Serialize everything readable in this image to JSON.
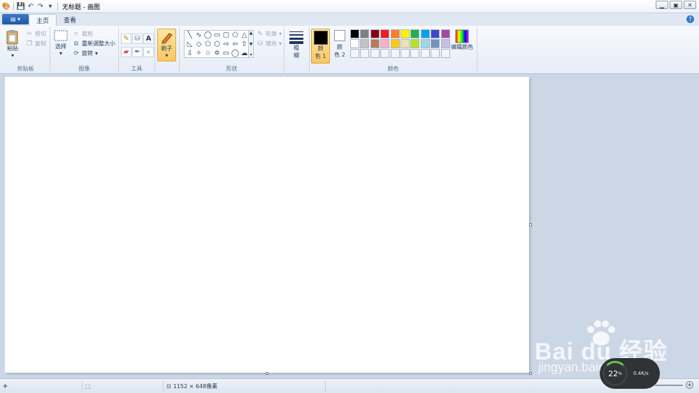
{
  "window": {
    "title": "无标题 - 画图"
  },
  "tabs": [
    {
      "label": "主页"
    },
    {
      "label": "查看"
    }
  ],
  "clipboard": {
    "paste": "粘贴",
    "cut": "剪切",
    "copy": "复制",
    "group": "剪贴板"
  },
  "image": {
    "select": "选择",
    "crop": "裁剪",
    "resize": "重新调整大小",
    "rotate": "旋转",
    "group": "图像"
  },
  "tools": {
    "group": "工具"
  },
  "brushes": {
    "label": "刷子"
  },
  "shapes": {
    "outline": "轮廓",
    "fill": "填充",
    "group": "形状"
  },
  "size": {
    "label_top": "粗",
    "label_bottom": "细"
  },
  "colors": {
    "color1_top": "颜",
    "color1_bottom": "色 1",
    "color2_top": "颜",
    "color2_bottom": "色 2",
    "edit": "编辑颜色",
    "group": "颜色",
    "color1": "#000000",
    "color2": "#ffffff",
    "palette_row1": [
      "#000000",
      "#7f7f7f",
      "#880015",
      "#ed1c24",
      "#ff7f27",
      "#fff200",
      "#22b14c",
      "#00a2e8",
      "#3f48cc",
      "#a349a4"
    ],
    "palette_row2": [
      "#ffffff",
      "#c3c3c3",
      "#b97a57",
      "#ffaec9",
      "#ffc90e",
      "#efe4b0",
      "#b5e61d",
      "#99d9ea",
      "#7092be",
      "#c8bfe7"
    ]
  },
  "status": {
    "canvas_size": "1152 × 648像素"
  },
  "speed_widget": {
    "percent": "22",
    "percent_sign": "%",
    "rate": "0.4K/s"
  },
  "watermark": {
    "logo": "Bai du 经验",
    "url": "jingyan.baidu.com"
  }
}
